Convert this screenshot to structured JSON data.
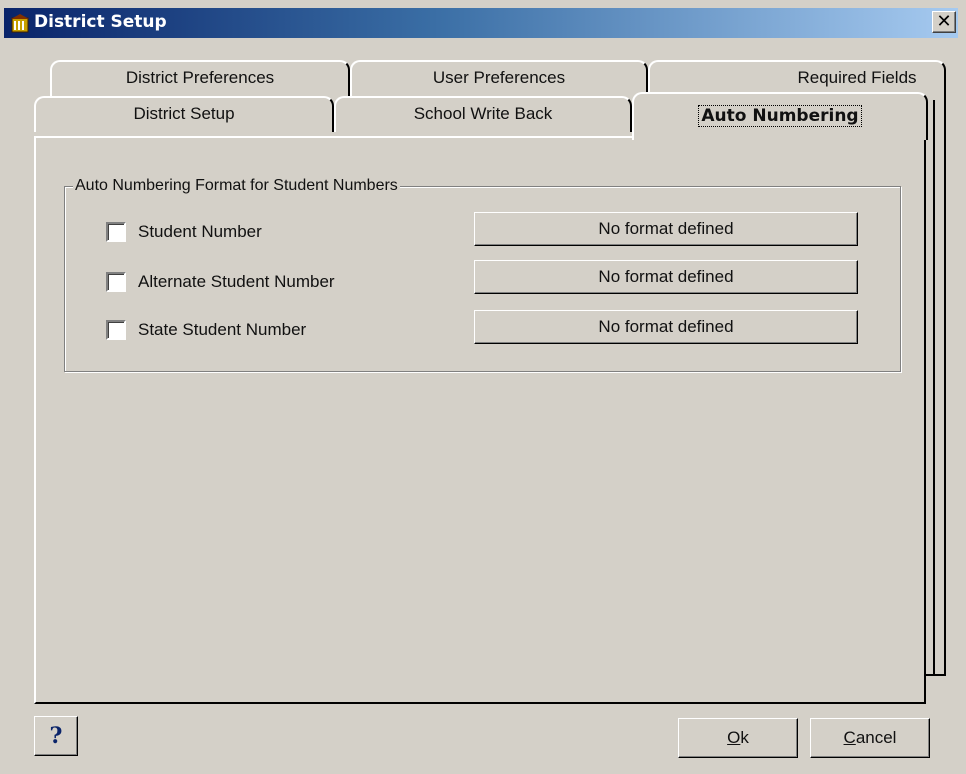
{
  "window": {
    "title": "District Setup",
    "close_glyph": "✕"
  },
  "icons": {
    "app": "district-setup-app-icon",
    "help": "?"
  },
  "tabs": {
    "row1": [
      "District Preferences",
      "User Preferences",
      "Required Fields"
    ],
    "row2": [
      "District Setup",
      "School Write Back",
      "Auto Numbering"
    ],
    "active": "Auto Numbering"
  },
  "group": {
    "legend": "Auto Numbering Format for Student Numbers",
    "rows": [
      {
        "label": "Student Number",
        "checked": false,
        "format": "No format defined"
      },
      {
        "label": "Alternate Student Number",
        "checked": false,
        "format": "No format defined"
      },
      {
        "label": "State Student Number",
        "checked": false,
        "format": "No format defined"
      }
    ]
  },
  "buttons": {
    "ok": {
      "accel": "O",
      "rest": "k"
    },
    "cancel": {
      "accel": "C",
      "rest": "ancel"
    }
  },
  "colors": {
    "face": "#d4d0c8",
    "title_start": "#0a246a",
    "title_end": "#a6caf0"
  }
}
